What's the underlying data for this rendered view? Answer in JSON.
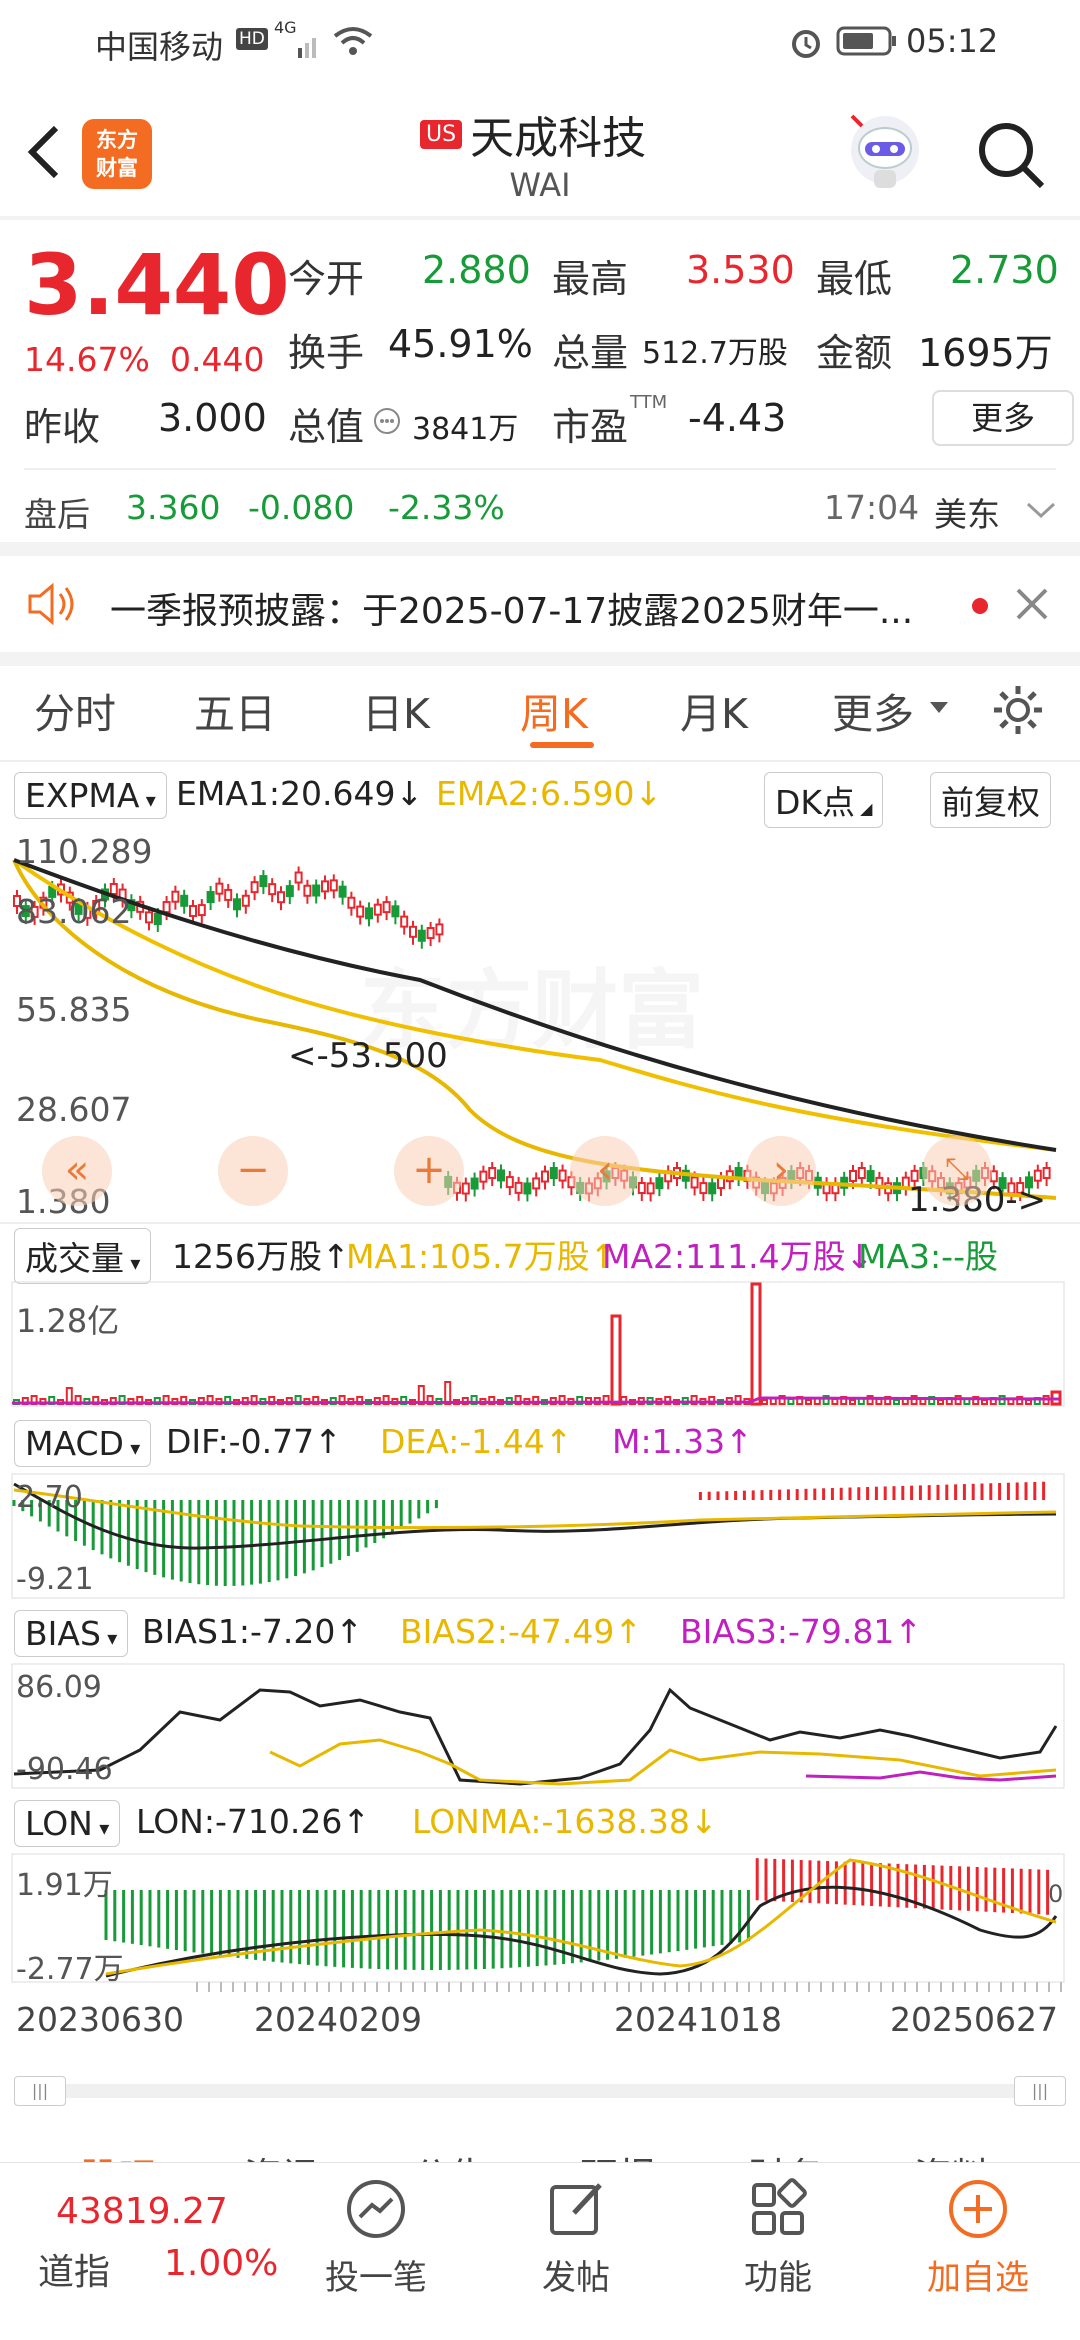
{
  "status_bar": {
    "carrier": "中国移动",
    "hd": "HD",
    "net": "4G",
    "time": "05:12"
  },
  "header": {
    "brand_line1": "东方",
    "brand_line2": "财富",
    "market_badge": "US",
    "stock_name": "天成科技",
    "ticker": "WAI"
  },
  "quote": {
    "price": "3.440",
    "change_pct": "14.67%",
    "change": "0.440",
    "open_label": "今开",
    "open": "2.880",
    "high_label": "最高",
    "high": "3.530",
    "low_label": "最低",
    "low": "2.730",
    "turnover_label": "换手",
    "turnover": "45.91%",
    "volume_label": "总量",
    "volume": "512.7万股",
    "amount_label": "金额",
    "amount": "1695万",
    "prev_close_label": "昨收",
    "prev_close": "3.000",
    "mktcap_label": "总值",
    "mktcap": "3841万",
    "pe_label": "市盈",
    "pe_sup": "TTM",
    "pe": "-4.43",
    "more_button": "更多"
  },
  "after_hours": {
    "label": "盘后",
    "price": "3.360",
    "change": "-0.080",
    "change_pct": "-2.33%",
    "time": "17:04",
    "zone": "美东"
  },
  "notice": {
    "text": "一季报预披露：于2025-07-17披露2025财年一..."
  },
  "tabs": [
    "分时",
    "五日",
    "日K",
    "周K",
    "月K",
    "更多"
  ],
  "active_tab": "周K",
  "main_chart": {
    "indicator": "EXPMA",
    "ema1": "EMA1:20.649",
    "ema2": "EMA2:6.590",
    "dk_button": "DK点",
    "adjust_button": "前复权",
    "y_labels": [
      "110.289",
      "83.062",
      "55.835",
      "28.607",
      "1.380"
    ],
    "high_marker": "<-53.500",
    "low_marker": "1.380->",
    "watermark": "东方财富"
  },
  "volume_panel": {
    "label": "成交量",
    "value": "1256万股",
    "ma1": "MA1:105.7万股",
    "ma2": "MA2:111.4万股",
    "ma3": "MA3:--股",
    "y_label": "1.28亿"
  },
  "macd_panel": {
    "label": "MACD",
    "dif": "DIF:-0.77",
    "dea": "DEA:-1.44",
    "m": "M:1.33",
    "y_top": "2.70",
    "y_bottom": "-9.21"
  },
  "bias_panel": {
    "label": "BIAS",
    "bias1": "BIAS1:-7.20",
    "bias2": "BIAS2:-47.49",
    "bias3": "BIAS3:-79.81",
    "y_top": "86.09",
    "y_bottom": "-90.46"
  },
  "lon_panel": {
    "label": "LON",
    "lon": "LON:-710.26",
    "lonma": "LONMA:-1638.38",
    "y_top": "1.91万",
    "y_bottom": "-2.77万",
    "right_label": "0"
  },
  "dates": [
    "20230630",
    "20240209",
    "20241018",
    "20250627"
  ],
  "bottom_tabs_partial": [
    "股吧",
    "资讯",
    "公告",
    "研报",
    "财务",
    "资料"
  ],
  "bottom_nav": {
    "index_value": "43819.27",
    "index_name": "道指",
    "index_change": "1.00%",
    "items": [
      "投一笔",
      "发帖",
      "功能",
      "加自选"
    ]
  },
  "colors": {
    "up": "#e8262d",
    "down": "#179b38",
    "accent": "#f36c21",
    "ema2": "#e8b800",
    "ma2": "#c020c0"
  }
}
